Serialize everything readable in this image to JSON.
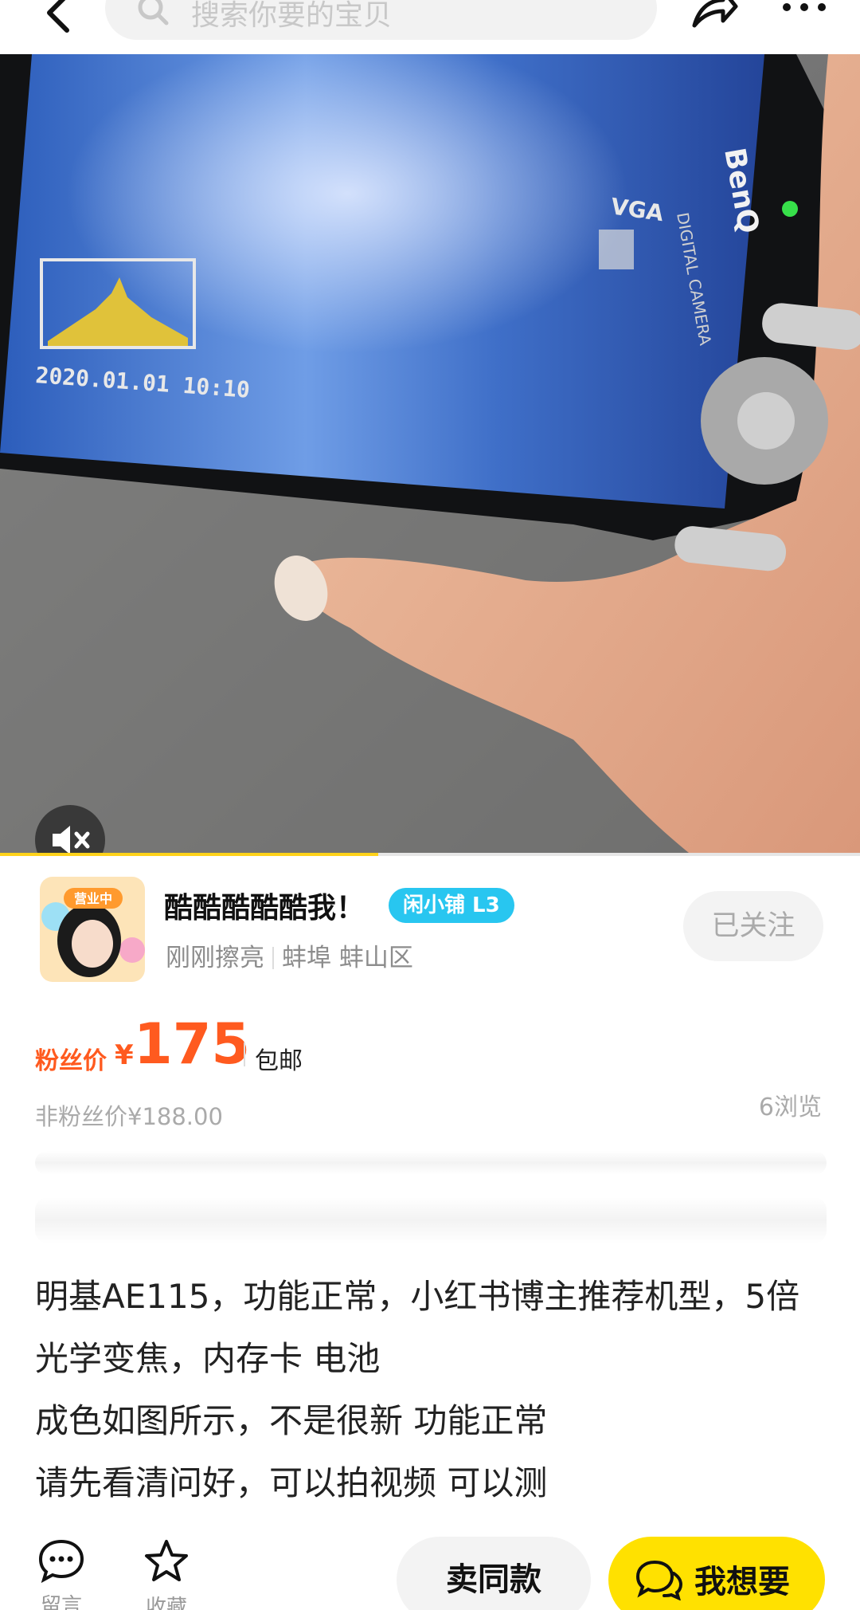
{
  "search": {
    "placeholder": "搜索你要的宝贝"
  },
  "media": {
    "progress_fraction": 0.44
  },
  "camera_screen": {
    "date_overlay": "2020.01.01 10:10",
    "brand": "BenQ",
    "sub_brand": "DIGITAL CAMERA",
    "mode_label": "VGA"
  },
  "seller": {
    "name": "酷酷酷酷酷我！",
    "shop_badge": "闲小铺 L3",
    "avatar_tag": "营业中",
    "activity": "刚刚擦亮",
    "city": "蚌埠",
    "district": "蚌山区",
    "follow_label": "已关注"
  },
  "price": {
    "fan_label": "粉丝价",
    "currency": "¥",
    "value": "175",
    "shipping": "包邮",
    "original": "非粉丝价¥188.00"
  },
  "stats": {
    "views": "6浏览"
  },
  "description": {
    "lines": [
      "明基AE115，功能正常，小红书博主推荐机型，5倍",
      "光学变焦，内存卡 电池",
      "成色如图所示，不是很新 功能正常",
      "请先看清问好，可以拍视频 可以测"
    ]
  },
  "bottom": {
    "comment_label": "留言",
    "fav_label": "收藏",
    "same_label": "卖同款",
    "want_label": "我想要"
  },
  "colors": {
    "accent_yellow": "#ffe100",
    "price_orange": "#ff5a1f",
    "badge_cyan": "#28c6f0"
  }
}
